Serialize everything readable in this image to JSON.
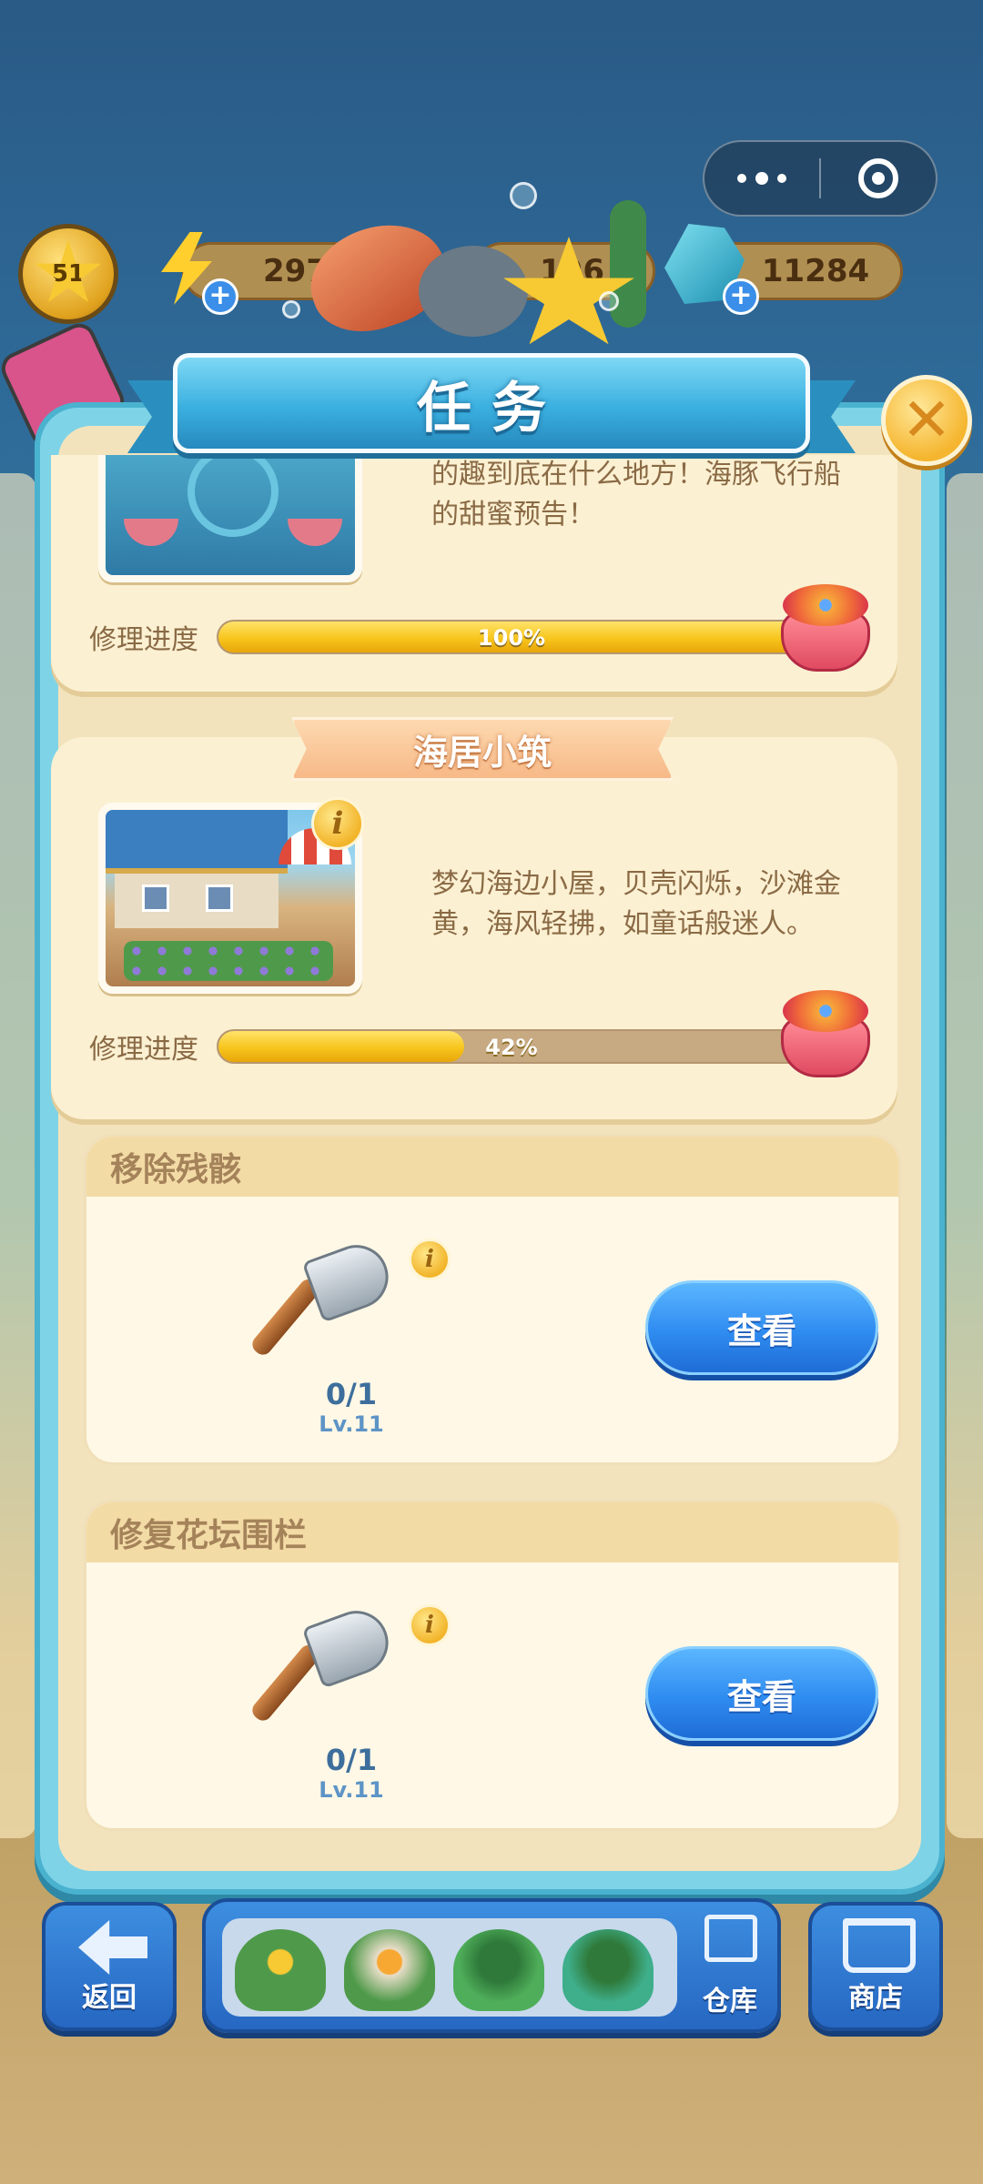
{
  "hud": {
    "level": "51",
    "energy": "297",
    "coins": "196",
    "gems": "11284"
  },
  "modal": {
    "title": "任务",
    "close_label": "✕"
  },
  "projects": [
    {
      "description": "的趣到底在什么地方！海豚飞行船的甜蜜预告！",
      "progress_label": "修理进度",
      "progress": 1.0,
      "progress_text": "100%"
    },
    {
      "name": "海居小筑",
      "description": "梦幻海边小屋，贝壳闪烁，沙滩金黄，海风轻拂，如童话般迷人。",
      "progress_label": "修理进度",
      "progress": 0.42,
      "progress_text": "42%",
      "info_icon": "i"
    }
  ],
  "tasks": [
    {
      "title": "移除残骸",
      "tool_icon": "axe-icon",
      "count": "0/1",
      "level": "Lv.11",
      "button_label": "查看",
      "info_icon": "i"
    },
    {
      "title": "修复花坛围栏",
      "tool_icon": "axe-icon",
      "count": "0/1",
      "level": "Lv.11",
      "button_label": "查看",
      "info_icon": "i"
    }
  ],
  "bottom_bar": {
    "back_label": "返回",
    "warehouse_label": "仓库",
    "shop_label": "商店"
  },
  "colors": {
    "modal_border": "#7fd3e6",
    "modal_body": "#f3e3bd",
    "button_blue": "#2f8cf0",
    "progress_fill": "#f7c51c",
    "progress_track": "#c7a982"
  }
}
